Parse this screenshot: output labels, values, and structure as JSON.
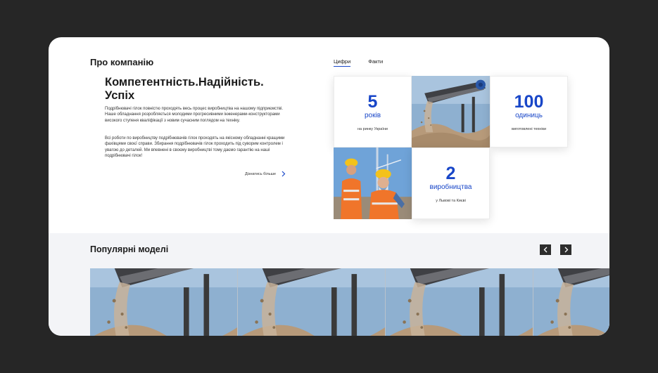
{
  "about": {
    "title": "Про компанію",
    "headline": "Компетентність.Надійність. Успіх",
    "paragraph1": "Подрібнювачі гілок повністю проходять весь процес виробництва на нашому підприємстві. Наше обладнання розробляється молодими прогресивними інженерами-конструкторами високого ступеня кваліфікації з новим сучасним поглядом на техніку.",
    "paragraph2": "Всі роботи по виробництву подрібнювачів гілок проходять на якісному обладнанні кращими фахівцями своєї справи. Збирання подрібнювачів гілок проходить під суворим контролем і увагою до деталей. Ми впевнені в своєму виробництві тому даємо гарантію на наші подрібнювачі гілок!",
    "more_link": "Дізнатись більше",
    "more_icon": "chevron-right-icon"
  },
  "tabs": [
    {
      "label": "Цифри",
      "active": true
    },
    {
      "label": "Факти",
      "active": false
    }
  ],
  "stats": [
    {
      "number": "5",
      "unit": "років",
      "desc": "на ринку України"
    },
    {
      "number": "100",
      "unit": "одиниць",
      "desc": "виготовлені техніки"
    },
    {
      "number": "2",
      "unit": "виробництва",
      "desc": "у Львові та Києві"
    }
  ],
  "images": {
    "conveyor": "conveyor-photo",
    "workers": "workers-photo"
  },
  "popular": {
    "title": "Популярні моделі",
    "prev_icon": "chevron-left-icon",
    "next_icon": "chevron-right-icon"
  },
  "colors": {
    "accent": "#1846c8",
    "frame": "#262626",
    "band": "#f3f4f7"
  }
}
